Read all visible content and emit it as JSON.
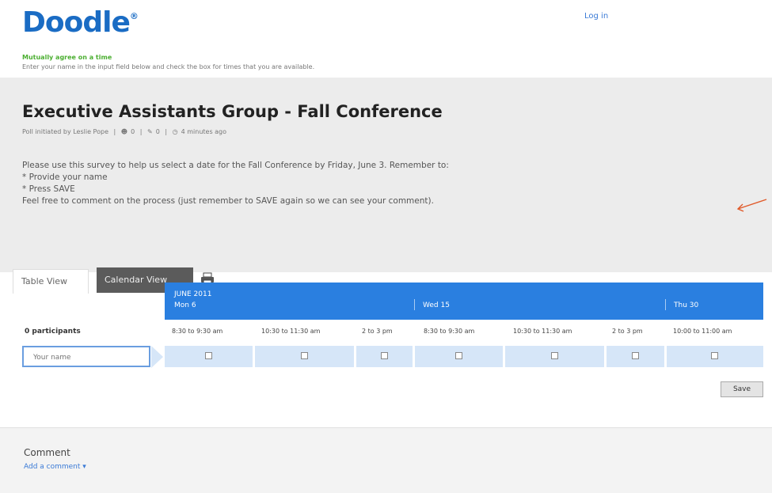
{
  "brand": {
    "logo": "Doodle",
    "logo_mark": "®"
  },
  "header": {
    "login": "Log in"
  },
  "tagline": "Mutually agree on a time",
  "subtagline": "Enter your name in the input field below and check the box for times that you are available.",
  "poll": {
    "title": "Executive Assistants Group - Fall Conference",
    "initiated_by": "Poll initiated by Leslie Pope",
    "participants_count": "0",
    "comments_count": "0",
    "time_ago": "4 minutes ago",
    "description": [
      "Please use this survey to help us select a date for the Fall Conference by Friday, June 3. Remember to:",
      "* Provide your name",
      "* Press SAVE",
      "Feel free to comment on the process (just remember to SAVE again so we can see your comment)."
    ]
  },
  "tabs": {
    "table_view": "Table View",
    "calendar_view": "Calendar View"
  },
  "grid": {
    "month": "JUNE 2011",
    "days": [
      "Mon 6",
      "Wed 15",
      "Thu 30"
    ],
    "participants_label": "0 participants",
    "times": [
      "8:30 to 9:30 am",
      "10:30 to 11:30 am",
      "2 to 3 pm",
      "8:30 to 9:30 am",
      "10:30 to 11:30 am",
      "2 to 3 pm",
      "10:00 to 11:00 am"
    ],
    "name_placeholder": "Your name"
  },
  "actions": {
    "save": "Save"
  },
  "comment": {
    "title": "Comment",
    "add": "Add a comment"
  },
  "colors": {
    "brand_blue": "#1a6cc4",
    "header_blue": "#2a7fe0",
    "cell_blue": "#d6e6f8",
    "tagline_green": "#4caf32"
  }
}
